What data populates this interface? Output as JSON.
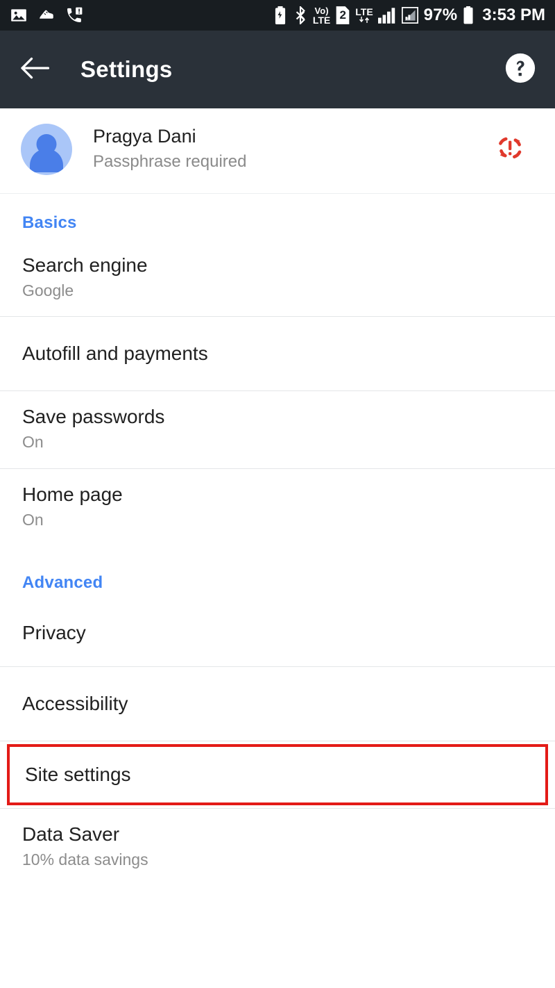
{
  "status_bar": {
    "left_icons": [
      "image-icon",
      "shoe-fitness-icon",
      "missed-call-icon"
    ],
    "right_icons": [
      "battery-saver-icon",
      "bluetooth-icon",
      "volte-icon",
      "sim2-icon",
      "lte-data-icon",
      "signal-bars-icon",
      "signal-bars-2-icon"
    ],
    "volte_top": "Vo)",
    "volte_bottom": "LTE",
    "sim_label": "2",
    "lte_label": "LTE",
    "battery_percent": "97%",
    "time": "3:53 PM"
  },
  "toolbar": {
    "title": "Settings",
    "back_icon": "back-arrow-icon",
    "help_icon": "help-circle-icon"
  },
  "account": {
    "name": "Pragya Dani",
    "status": "Passphrase required",
    "sync_error_icon": "sync-error-icon",
    "avatar_icon": "account-avatar-icon"
  },
  "sections": [
    {
      "header": "Basics",
      "items": [
        {
          "title": "Search engine",
          "subtitle": "Google"
        },
        {
          "title": "Autofill and payments",
          "subtitle": ""
        },
        {
          "title": "Save passwords",
          "subtitle": "On"
        },
        {
          "title": "Home page",
          "subtitle": "On"
        }
      ]
    },
    {
      "header": "Advanced",
      "items": [
        {
          "title": "Privacy",
          "subtitle": ""
        },
        {
          "title": "Accessibility",
          "subtitle": ""
        },
        {
          "title": "Site settings",
          "subtitle": "",
          "highlighted": true
        },
        {
          "title": "Data Saver",
          "subtitle": "10% data savings"
        }
      ]
    }
  ],
  "colors": {
    "status_bar_bg": "#181d21",
    "toolbar_bg": "#2a3139",
    "accent_blue": "#4285f4",
    "highlight_red": "#e31b17",
    "sync_error_red": "#e0392c",
    "avatar_bg": "#aac6f8",
    "avatar_fg": "#4a7ee8",
    "primary_text": "#212121",
    "secondary_text": "#8c8c8c"
  }
}
